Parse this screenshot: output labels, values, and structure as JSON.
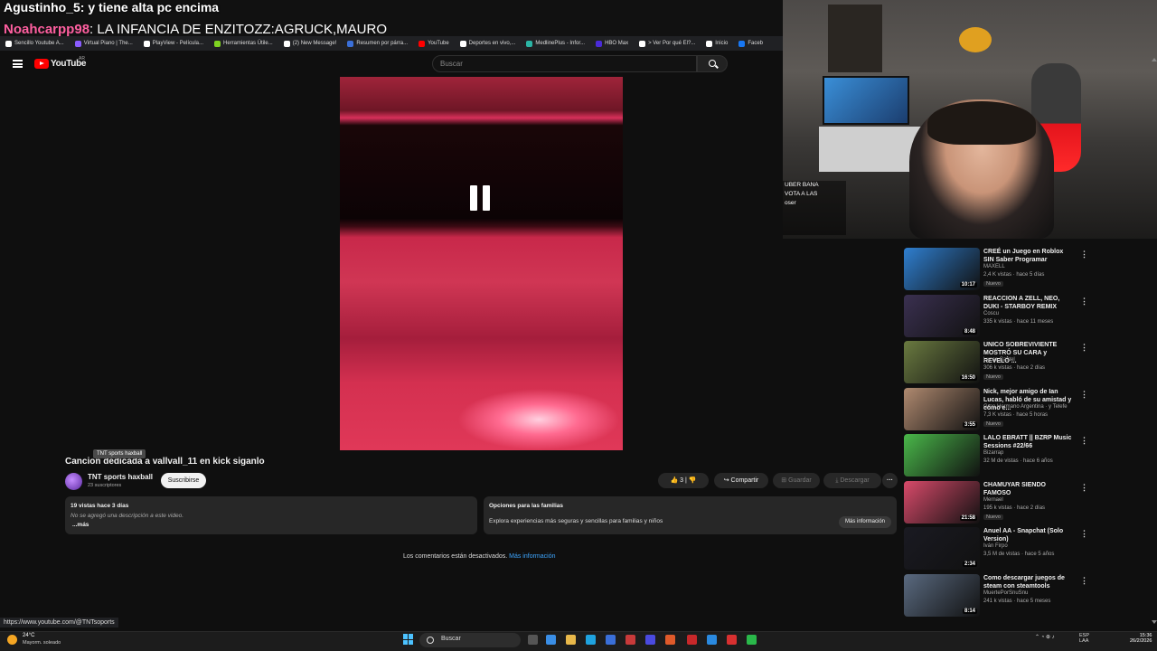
{
  "chat_overlay": {
    "line1": "Agustinho_5: y tiene alta pc encima",
    "line2_nick": "Noahcarpp98",
    "line2_msg": ": LA INFANCIA DE ENZITOZZ:AGRUCK,MAURO"
  },
  "bookmarks": [
    {
      "label": "Sencillo Youtube A...",
      "color": "#ffffff"
    },
    {
      "label": "Virtual Piano | The...",
      "color": "#8a5cff"
    },
    {
      "label": "PlayView - Película...",
      "color": "#ffffff"
    },
    {
      "label": "Herramientas Útile...",
      "color": "#7ed321"
    },
    {
      "label": "(2) New Message!",
      "color": "#ffffff"
    },
    {
      "label": "Resumen por párra...",
      "color": "#3a6fd8"
    },
    {
      "label": "YouTube",
      "color": "#ff0000"
    },
    {
      "label": "Deportes en vivo,...",
      "color": "#ffffff"
    },
    {
      "label": "MedlinePlus - Infor...",
      "color": "#2bb5a5"
    },
    {
      "label": "HBO Max",
      "color": "#4a2bd8"
    },
    {
      "label": "> Ver Por qué El?...",
      "color": "#ffffff"
    },
    {
      "label": "Inicio",
      "color": "#ffffff"
    },
    {
      "label": "Faceb",
      "color": "#1877f2"
    }
  ],
  "header": {
    "logo_text": "YouTube",
    "country": "AR",
    "search_placeholder": "Buscar"
  },
  "video": {
    "title": "Cancion dedicada a vallvall_11 en kick siganlo",
    "channel": "TNT sports haxball",
    "tooltip": "TNT sports haxball",
    "subscribers": "23 suscriptores",
    "subscribe_label": "Suscribirse",
    "likes": "3",
    "share_label": "Compartir",
    "save_label": "Guardar",
    "download_label": "Descargar",
    "more_label": "···"
  },
  "description": {
    "meta": "19 vistas  hace 3 días",
    "text": "No se agregó una descripción a este video.",
    "more": "...más"
  },
  "family": {
    "title": "Opciones para las familias",
    "text": "Explora experiencias más seguras y sencillas para familias y niños",
    "button": "Más información"
  },
  "comments": {
    "text": "Los comentarios están desactivados.",
    "link": "Más información"
  },
  "status_url": "https://www.youtube.com/@TNTsoports",
  "webcam_chat": [
    "UBER BANA",
    "VOTA A LAS",
    "oser"
  ],
  "recommendations": [
    {
      "title": "CREÉ un Juego en Roblox SIN Saber Programar",
      "channel": "MAXELL",
      "views": "2,4 K vistas · hace 5 días",
      "badge": "Nuevo",
      "duration": "10:17",
      "thumb": "#2f7fd0"
    },
    {
      "title": "REACCION A ZELL, NEO, DUKI - STARBOY REMIX",
      "channel": "Coscu",
      "views": "335 k vistas · hace 11 meses",
      "badge": "",
      "duration": "8:48",
      "thumb": "#3a3050"
    },
    {
      "title": "UNICO SOBREVIVIENTE MOSTRÓ SU CARA y REVELÓ ...",
      "channel": "Lucas Castel",
      "views": "306 k vistas · hace 2 días",
      "badge": "Nuevo",
      "duration": "16:50",
      "thumb": "#6a7a40"
    },
    {
      "title": "Nick, mejor amigo de Ian Lucas, habló de su amistad y cómo e...",
      "channel": "Gran Hermano Argentina · y Telefe",
      "views": "7,3 K vistas · hace 5 horas",
      "badge": "Nuevo",
      "duration": "3:55",
      "thumb": "#b08a70"
    },
    {
      "title": "LALO EBRATT || BZRP Music Sessions #22/66",
      "channel": "Bizarrap",
      "views": "32 M de vistas · hace 6 años",
      "badge": "",
      "duration": "",
      "thumb": "#4ab84a"
    },
    {
      "title": "CHAMUYAR SIENDO FAMOSO",
      "channel": "Mernael",
      "views": "195 k vistas · hace 2 días",
      "badge": "Nuevo",
      "duration": "21:58",
      "thumb": "#d84a6a"
    },
    {
      "title": "Anuel AA - Snapchat (Solo Version)",
      "channel": "Iván Firpo",
      "views": "3,5 M de vistas · hace 5 años",
      "badge": "",
      "duration": "2:34",
      "thumb": "#1a1a22"
    },
    {
      "title": "Como descargar juegos de steam con steamtools",
      "channel": "MuertePorSnuSnu",
      "views": "241 k vistas · hace 5 meses",
      "badge": "",
      "duration": "8:14",
      "thumb": "#5a6a80"
    }
  ],
  "taskbar": {
    "temperature": "24°C",
    "weather": "Mayorm. soleado",
    "search_label": "Buscar",
    "lang1": "ESP",
    "lang2": "LAA",
    "time": "15:36",
    "date": "26/2/2026",
    "apps": [
      "#555555",
      "#3a8ee6",
      "#e8b84a",
      "#1fa3e0",
      "#3a6fd8",
      "#c83a3a",
      "#4a4ae0",
      "#e05a2a",
      "#c8282a",
      "#2a8ae0",
      "#d83030",
      "#2ab84a"
    ]
  }
}
